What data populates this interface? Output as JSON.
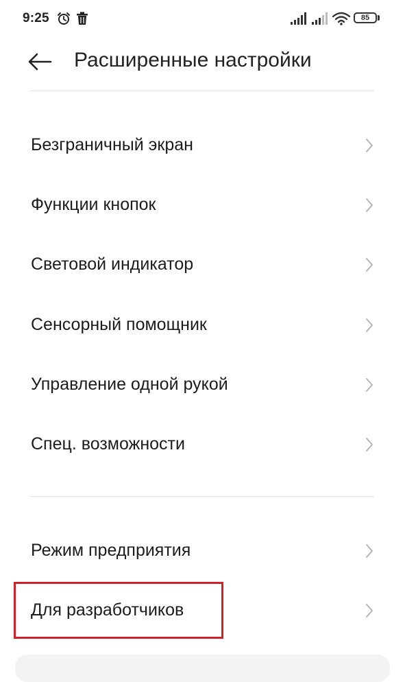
{
  "status_bar": {
    "time": "9:25",
    "battery_level": "85",
    "icons": [
      "alarm-icon",
      "trash-icon",
      "signal-icon",
      "signal-icon-2",
      "wifi-icon",
      "battery-icon"
    ]
  },
  "header": {
    "title": "Расширенные настройки",
    "back_icon": "arrow-left-icon"
  },
  "group1": {
    "items": [
      {
        "label": "Безграничный экран"
      },
      {
        "label": "Функции кнопок"
      },
      {
        "label": "Световой индикатор"
      },
      {
        "label": "Сенсорный помощник"
      },
      {
        "label": "Управление одной рукой"
      },
      {
        "label": "Спец. возможности"
      }
    ]
  },
  "group2": {
    "items": [
      {
        "label": "Режим предприятия"
      },
      {
        "label": "Для разработчиков"
      }
    ]
  },
  "colors": {
    "highlight": "#d0202a",
    "divider": "#e4e4e4",
    "chevron": "#b5b5b5",
    "text": "#1c1c1c"
  }
}
